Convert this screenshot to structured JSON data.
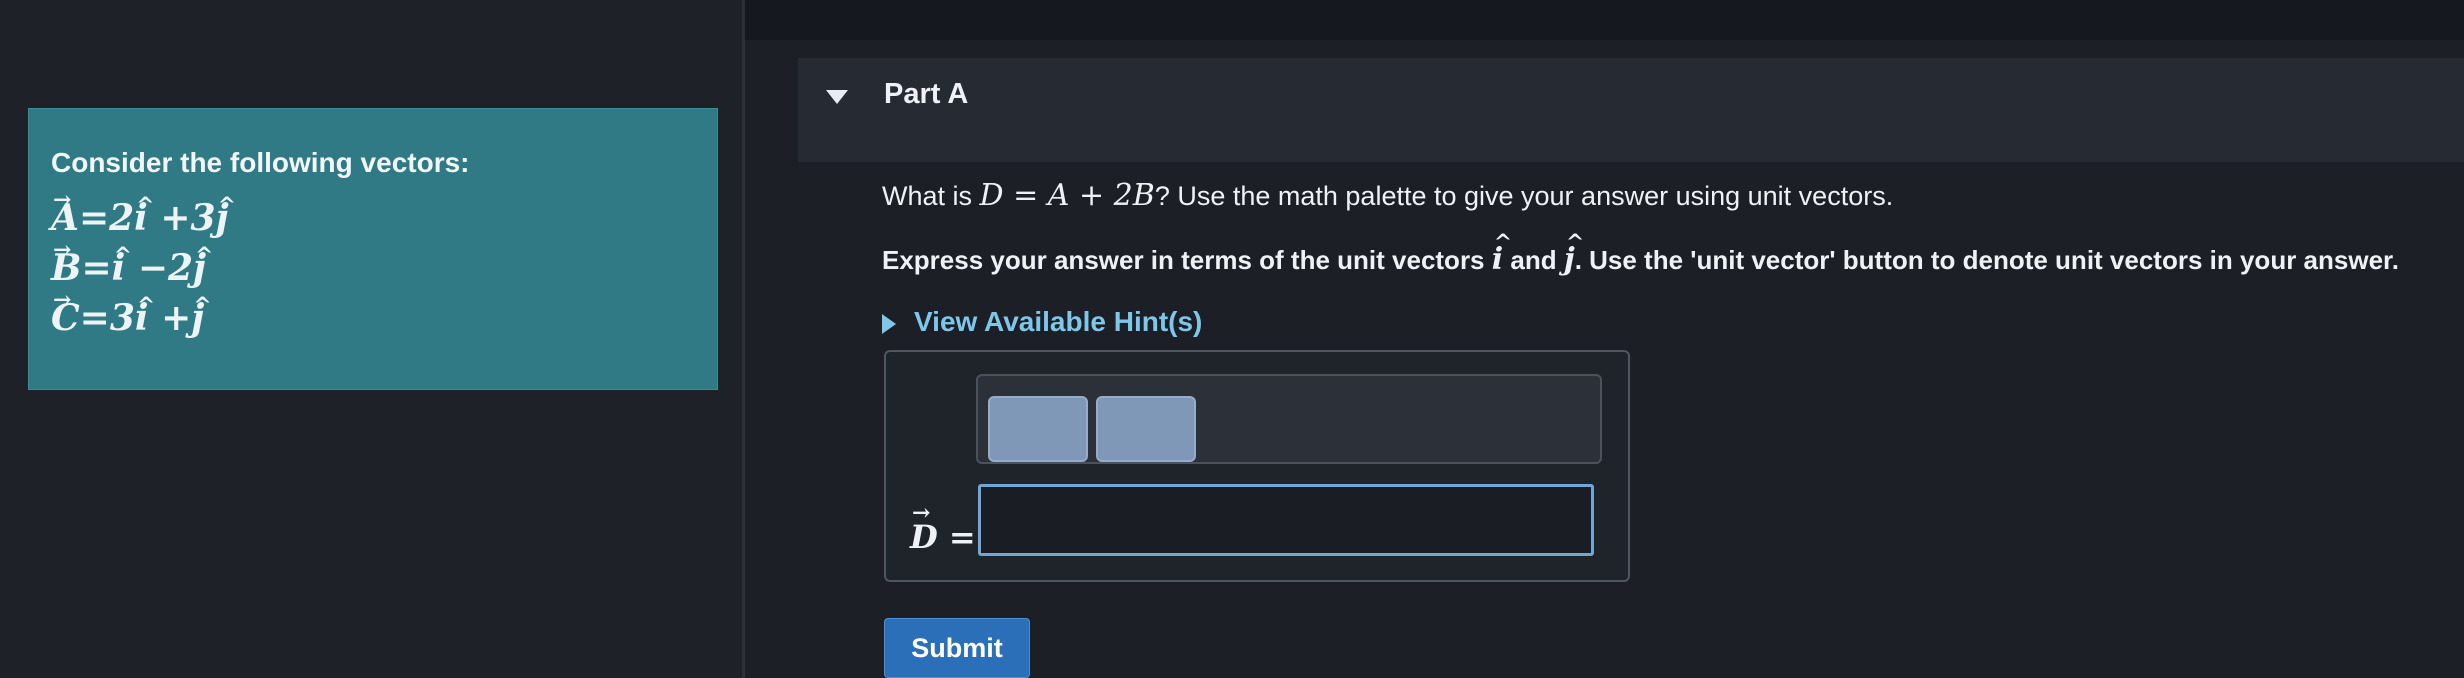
{
  "vectors_panel": {
    "title": "Consider the following vectors:",
    "vectors": [
      {
        "name": "A",
        "equals": "=2",
        "unit1": "i",
        "op": " +3",
        "unit2": "j"
      },
      {
        "name": "B",
        "equals": "=",
        "unit1": "i",
        "op": " −2",
        "unit2": "j"
      },
      {
        "name": "C",
        "equals": "=3",
        "unit1": "i",
        "op": " +",
        "unit2": "j"
      }
    ]
  },
  "part": {
    "label": "Part A",
    "question_prefix": "What is ",
    "question_math": "D = A + 2B",
    "question_suffix": "? Use the math palette to give your answer using unit vectors.",
    "instruction_prefix": "Express your answer in terms of the unit vectors ",
    "unit_i": "i",
    "instruction_and": " and ",
    "unit_j": "j",
    "instruction_suffix": ". Use the 'unit vector' button to denote unit vectors in your answer.",
    "hint_link": "View Available Hint(s)"
  },
  "answer": {
    "label_vector": "D",
    "label_equals": " =",
    "input_value": ""
  },
  "submit": {
    "label": "Submit"
  }
}
